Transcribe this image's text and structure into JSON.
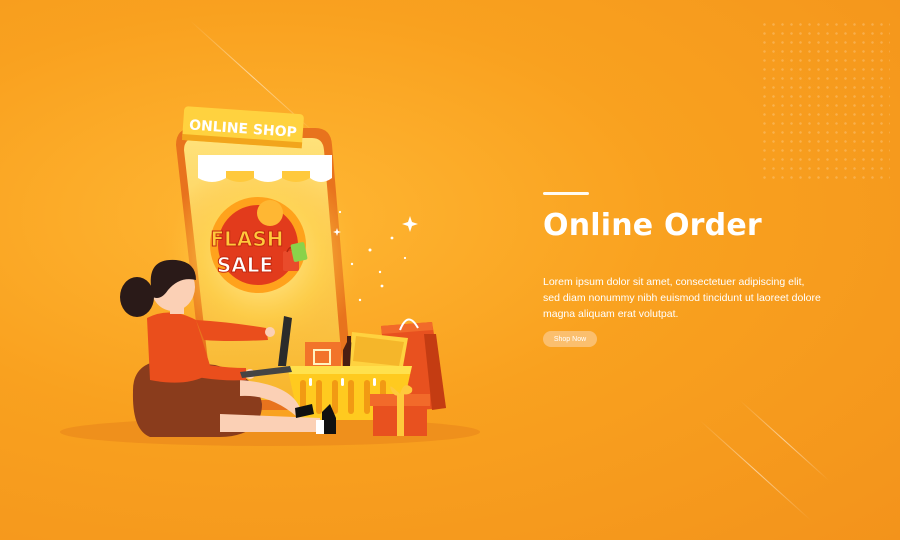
{
  "hero": {
    "headline": "Online Order",
    "body": "Lorem ipsum dolor sit amet, consectetuer adipiscing elit, sed diam nonummy nibh euismod tincidunt ut laoreet dolore magna aliquam erat volutpat.",
    "cta_label": "Shop Now"
  },
  "illustration": {
    "shop_sign": "ONLINE SHOP",
    "badge_line1": "FLASH",
    "badge_line2": "SALE"
  },
  "colors": {
    "background": "#f9a11f",
    "shop_sign": "#ffd23f",
    "badge_red": "#e23b1c",
    "cta": "#fbbf6e"
  },
  "icons": [
    "sparkle-icon",
    "shopping-bag-icon",
    "gift-box-icon",
    "shopping-basket-icon",
    "laptop-icon"
  ]
}
